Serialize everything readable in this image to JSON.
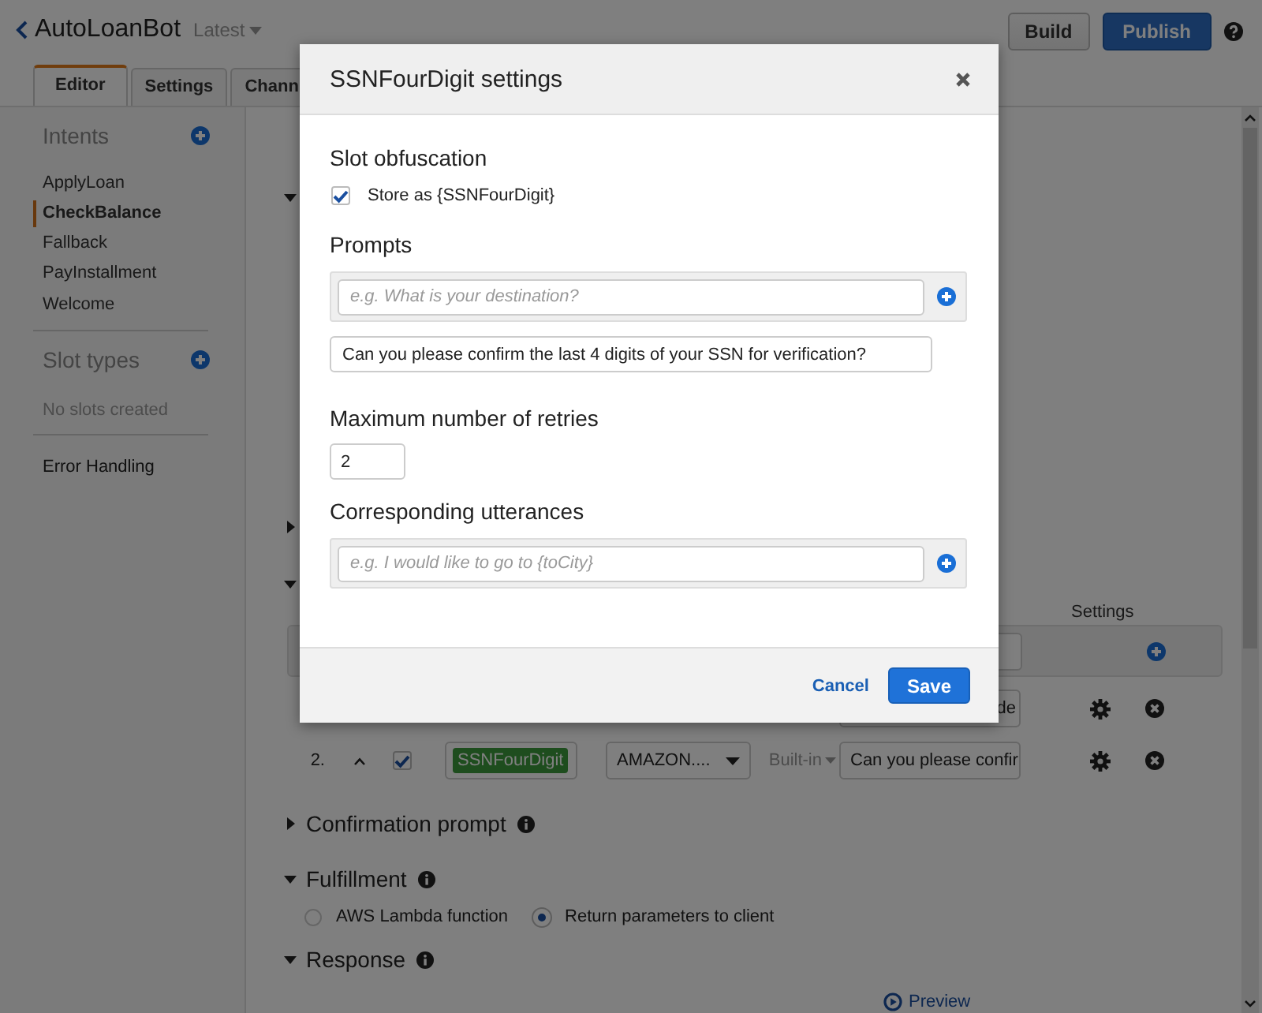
{
  "header": {
    "bot_name": "AutoLoanBot",
    "version": "Latest",
    "buttons": [
      {
        "label": "Build",
        "kind": "default"
      },
      {
        "label": "Publish",
        "kind": "primary"
      }
    ]
  },
  "tabs": [
    {
      "label": "Editor",
      "selected": true
    },
    {
      "label": "Settings",
      "selected": false
    },
    {
      "label": "Chann",
      "selected": false
    }
  ],
  "sidebar": {
    "sections": [
      {
        "title": "Intents",
        "kind": "list",
        "items": [
          {
            "label": "ApplyLoan",
            "selected": false
          },
          {
            "label": "CheckBalance",
            "selected": true
          },
          {
            "label": "Fallback",
            "selected": false
          },
          {
            "label": "PayInstallment",
            "selected": false
          },
          {
            "label": "Welcome",
            "selected": false
          }
        ]
      },
      {
        "title": "Slot types",
        "kind": "empty",
        "empty_text": "No slots created"
      },
      {
        "title": "Error Handling",
        "kind": "link"
      }
    ]
  },
  "hidden_sections": [
    {
      "expanded": true
    },
    {
      "expanded": false
    },
    {
      "expanded": true
    }
  ],
  "slots": {
    "settings_heading": "Settings",
    "rows": [
      {
        "prompt": "de"
      },
      {
        "number": "2.",
        "required": true,
        "name": "SSNFourDigit",
        "type": "AMAZON....",
        "source": "Built-in",
        "prompt": "Can you please confir"
      }
    ]
  },
  "sections": [
    {
      "title": "Confirmation prompt",
      "expanded": false
    },
    {
      "title": "Fulfillment",
      "expanded": true,
      "options": [
        {
          "label": "AWS Lambda function",
          "selected": false
        },
        {
          "label": "Return parameters to client",
          "selected": true
        }
      ]
    },
    {
      "title": "Response",
      "expanded": true
    }
  ],
  "preview": "Preview",
  "dialog": {
    "title": "SSNFourDigit settings",
    "obfuscation": {
      "heading": "Slot obfuscation",
      "checked": true,
      "label": "Store as {SSNFourDigit}"
    },
    "prompts": {
      "heading": "Prompts",
      "placeholder": "e.g. What is your destination?",
      "values": [
        "Can you please confirm the last 4 digits of your SSN for verification?"
      ]
    },
    "retries": {
      "heading": "Maximum number of retries",
      "value": "2"
    },
    "utterances": {
      "heading": "Corresponding utterances",
      "placeholder": "e.g. I would like to go to {toCity}"
    },
    "buttons": [
      {
        "label": "Cancel",
        "kind": "link"
      },
      {
        "label": "Save",
        "kind": "primary"
      }
    ]
  }
}
